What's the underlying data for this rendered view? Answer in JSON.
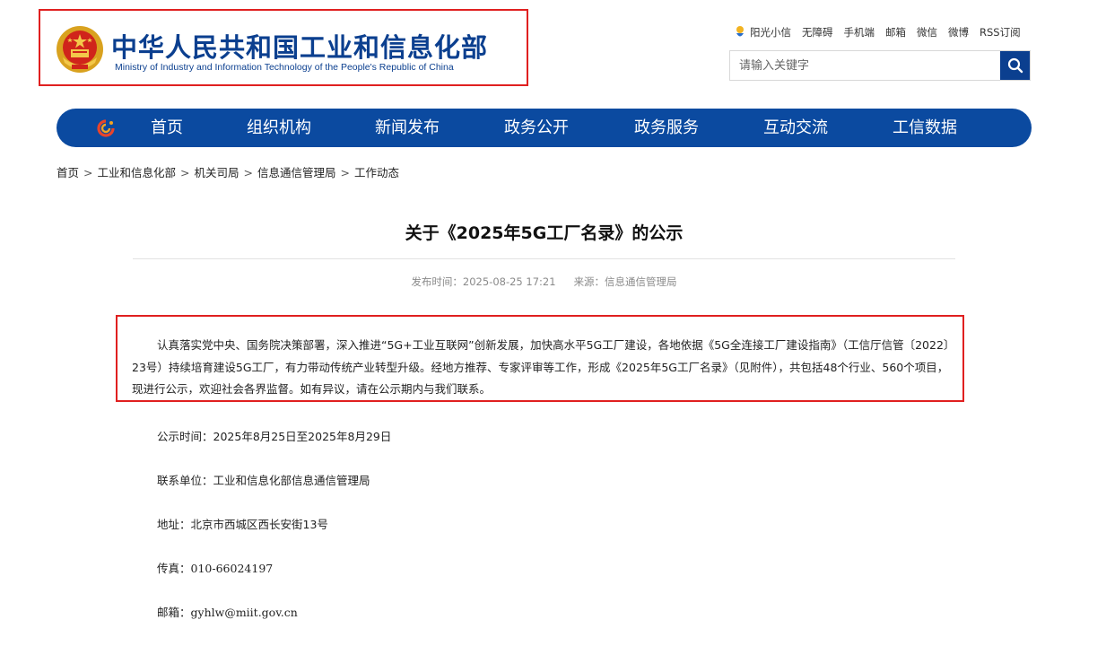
{
  "header": {
    "title_cn": "中华人民共和国工业和信息化部",
    "title_en": "Ministry of Industry and Information Technology of the People's Republic of China",
    "top_links": [
      "阳光小信",
      "无障碍",
      "手机端",
      "邮箱",
      "微信",
      "微博",
      "RSS订阅"
    ],
    "search_placeholder": "请输入关键字"
  },
  "nav": {
    "items": [
      "首页",
      "组织机构",
      "新闻发布",
      "政务公开",
      "政务服务",
      "互动交流",
      "工信数据"
    ]
  },
  "breadcrumb": [
    "首页",
    "工业和信息化部",
    "机关司局",
    "信息通信管理局",
    "工作动态"
  ],
  "article": {
    "title": "关于《2025年5G工厂名录》的公示",
    "publish_time": "发布时间：2025-08-25 17:21",
    "source": "来源：信息通信管理局",
    "paragraph": "认真落实党中央、国务院决策部署，深入推进“5G+工业互联网”创新发展，加快高水平5G工厂建设，各地依据《5G全连接工厂建设指南》（工信厅信管〔2022〕23号）持续培育建设5G工厂，有力带动传统产业转型升级。经地方推荐、专家评审等工作，形成《2025年5G工厂名录》（见附件），共包括48个行业、560个项目，现进行公示，欢迎社会各界监督。如有异议，请在公示期内与我们联系。",
    "info": [
      {
        "label": "公示时间：",
        "value": "2025年8月25日至2025年8月29日"
      },
      {
        "label": "联系单位：",
        "value": "工业和信息化部信息通信管理局"
      },
      {
        "label": "地址：",
        "value": "北京市西城区西长安街13号"
      },
      {
        "label": "传真：",
        "value": "010-66024197"
      },
      {
        "label": "邮箱：",
        "value": "gyhlw@miit.gov.cn"
      }
    ]
  },
  "colors": {
    "brand_blue": "#0b3f8f",
    "nav_blue": "#0b4aa0",
    "highlight_red": "#e02020"
  }
}
